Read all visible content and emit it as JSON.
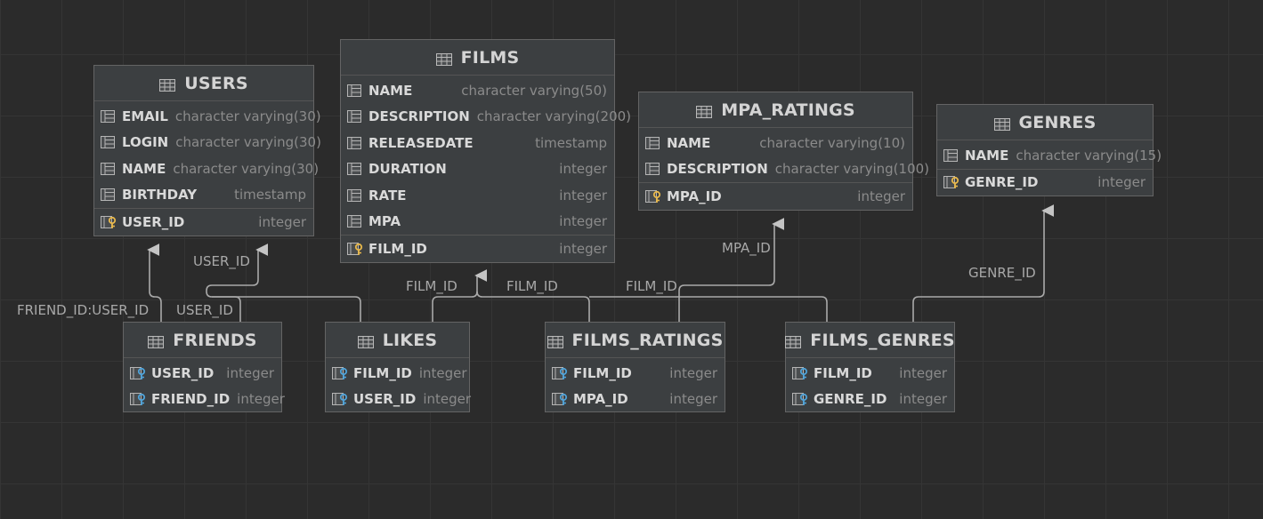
{
  "tables": {
    "users": {
      "title": "USERS",
      "columns": [
        {
          "name": "EMAIL",
          "type": "character varying(30)"
        },
        {
          "name": "LOGIN",
          "type": "character varying(30)"
        },
        {
          "name": "NAME",
          "type": "character varying(30)"
        },
        {
          "name": "BIRTHDAY",
          "type": "timestamp"
        }
      ],
      "keys": [
        {
          "name": "USER_ID",
          "type": "integer"
        }
      ]
    },
    "films": {
      "title": "FILMS",
      "columns": [
        {
          "name": "NAME",
          "type": "character varying(50)"
        },
        {
          "name": "DESCRIPTION",
          "type": "character varying(200)"
        },
        {
          "name": "RELEASEDATE",
          "type": "timestamp"
        },
        {
          "name": "DURATION",
          "type": "integer"
        },
        {
          "name": "RATE",
          "type": "integer"
        },
        {
          "name": "MPA",
          "type": "integer"
        }
      ],
      "keys": [
        {
          "name": "FILM_ID",
          "type": "integer"
        }
      ]
    },
    "mpa_ratings": {
      "title": "MPA_RATINGS",
      "columns": [
        {
          "name": "NAME",
          "type": "character varying(10)"
        },
        {
          "name": "DESCRIPTION",
          "type": "character varying(100)"
        }
      ],
      "keys": [
        {
          "name": "MPA_ID",
          "type": "integer"
        }
      ]
    },
    "genres": {
      "title": "GENRES",
      "columns": [
        {
          "name": "NAME",
          "type": "character varying(15)"
        }
      ],
      "keys": [
        {
          "name": "GENRE_ID",
          "type": "integer"
        }
      ]
    },
    "friends": {
      "title": "FRIENDS",
      "keys": [
        {
          "name": "USER_ID",
          "type": "integer"
        },
        {
          "name": "FRIEND_ID",
          "type": "integer"
        }
      ]
    },
    "likes": {
      "title": "LIKES",
      "keys": [
        {
          "name": "FILM_ID",
          "type": "integer"
        },
        {
          "name": "USER_ID",
          "type": "integer"
        }
      ]
    },
    "films_ratings": {
      "title": "FILMS_RATINGS",
      "keys": [
        {
          "name": "FILM_ID",
          "type": "integer"
        },
        {
          "name": "MPA_ID",
          "type": "integer"
        }
      ]
    },
    "films_genres": {
      "title": "FILMS_GENRES",
      "keys": [
        {
          "name": "FILM_ID",
          "type": "integer"
        },
        {
          "name": "GENRE_ID",
          "type": "integer"
        }
      ]
    }
  },
  "relations": {
    "friend_id_user_id": "FRIEND_ID:USER_ID",
    "friends_user_id": "USER_ID",
    "likes_user_id": "USER_ID",
    "likes_film_id": "FILM_ID",
    "films_ratings_film_id": "FILM_ID",
    "films_genres_film_id": "FILM_ID",
    "mpa_id": "MPA_ID",
    "genre_id": "GENRE_ID"
  },
  "icons": {
    "table": "table-icon",
    "column": "column-icon",
    "primary_key": "primary-key-icon",
    "foreign_key": "foreign-key-icon"
  },
  "colors": {
    "background": "#2b2b2b",
    "table_bg": "#3c3f41",
    "line": "#a9a9a9",
    "key_gold": "#e8b84b",
    "key_blue": "#4fa3d9"
  }
}
